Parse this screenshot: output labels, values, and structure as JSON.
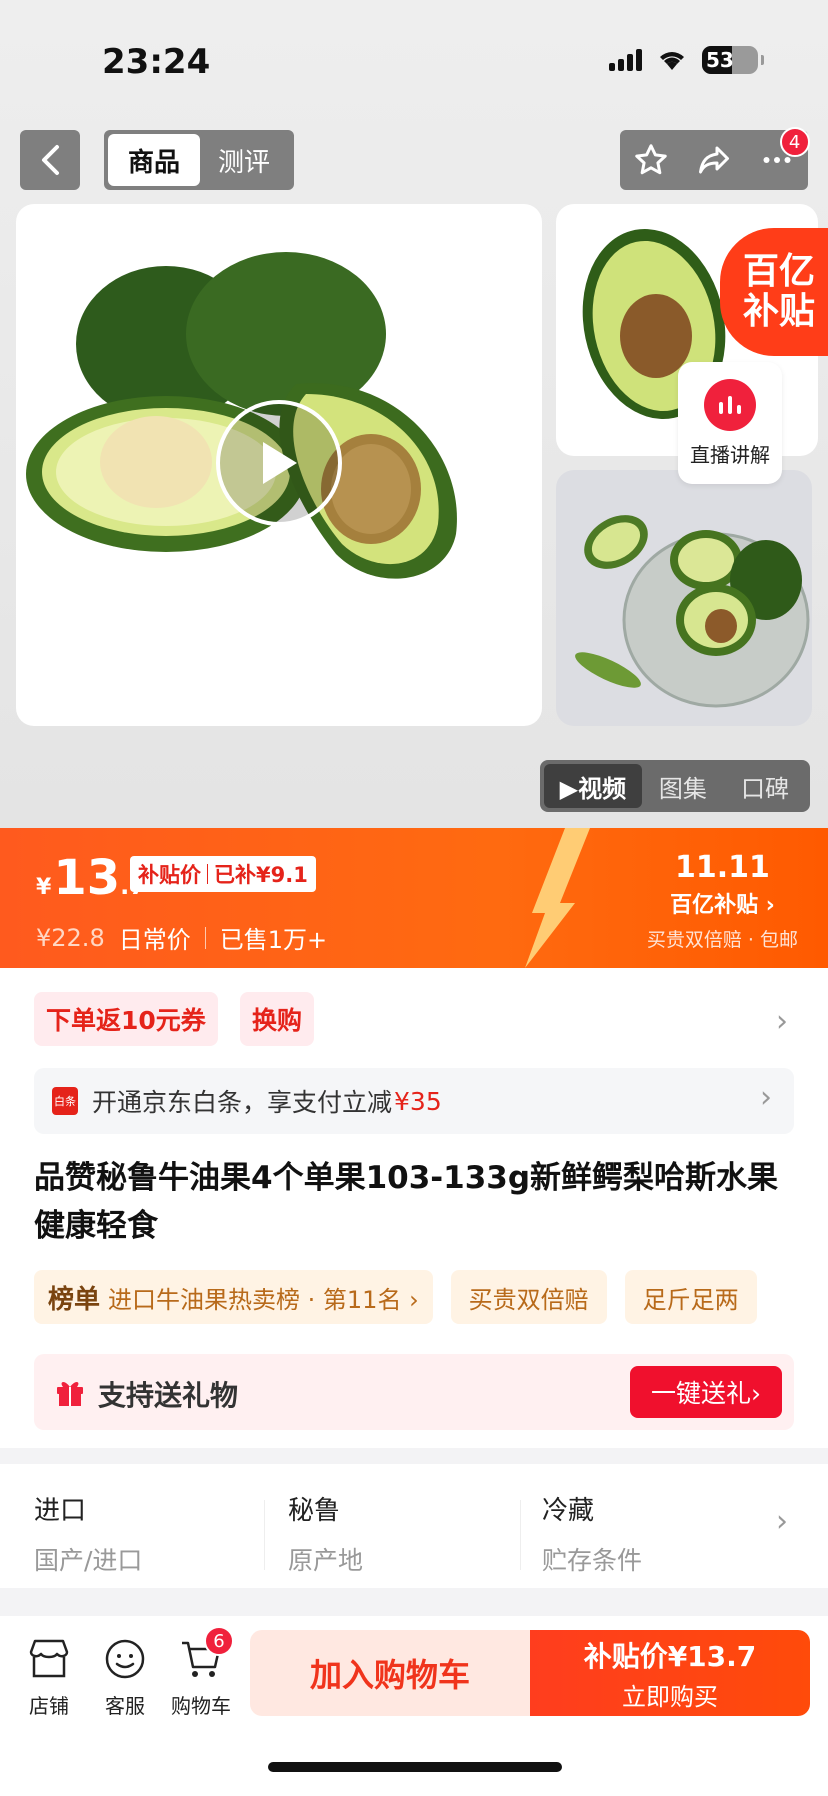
{
  "status": {
    "time": "23:24",
    "battery": "53"
  },
  "nav": {
    "tabs": [
      "商品",
      "测评"
    ],
    "badge": "4"
  },
  "gallery": {
    "subsidy_line1": "百亿",
    "subsidy_line2": "补贴",
    "live_label": "直播讲解",
    "media_tabs": [
      "▶视频",
      "图集",
      "口碑"
    ]
  },
  "price": {
    "yen": "¥",
    "int": "13",
    "dec": ".7",
    "tag_left": "补贴价",
    "tag_right": "已补¥9.1",
    "original": "¥22.8",
    "daily_label": "日常价",
    "sold": "已售1万+",
    "promo_11": "11.11",
    "promo_sub": "百亿补贴 ›",
    "promo_note": "买贵双倍赔 · 包邮"
  },
  "chips": [
    "下单返10元券",
    "换购"
  ],
  "baitiao": {
    "icon": "白条",
    "text": "开通京东白条，享支付立减",
    "amount": "¥35"
  },
  "title": "品赞秘鲁牛油果4个单果103-133g新鲜鳄梨哈斯水果健康轻食",
  "tags": {
    "rank_label": "榜单",
    "rank_text": "进口牛油果热卖榜 · 第11名 ›",
    "items": [
      "买贵双倍赔",
      "足斤足两"
    ]
  },
  "gift": {
    "label": "支持送礼物",
    "button": "一键送礼›"
  },
  "attributes": [
    {
      "value": "进口",
      "key": "国产/进口"
    },
    {
      "value": "秘鲁",
      "key": "原产地"
    },
    {
      "value": "冷藏",
      "key": "贮存条件"
    }
  ],
  "bottom": {
    "store": "店铺",
    "service": "客服",
    "cart": "购物车",
    "cart_count": "6",
    "add_cart": "加入购物车",
    "buy_price": "补贴价¥13.7",
    "buy_label": "立即购买"
  },
  "colors": {
    "accent": "#ff5a1e",
    "red": "#f0213c",
    "subsidy": "#ff3d18"
  }
}
